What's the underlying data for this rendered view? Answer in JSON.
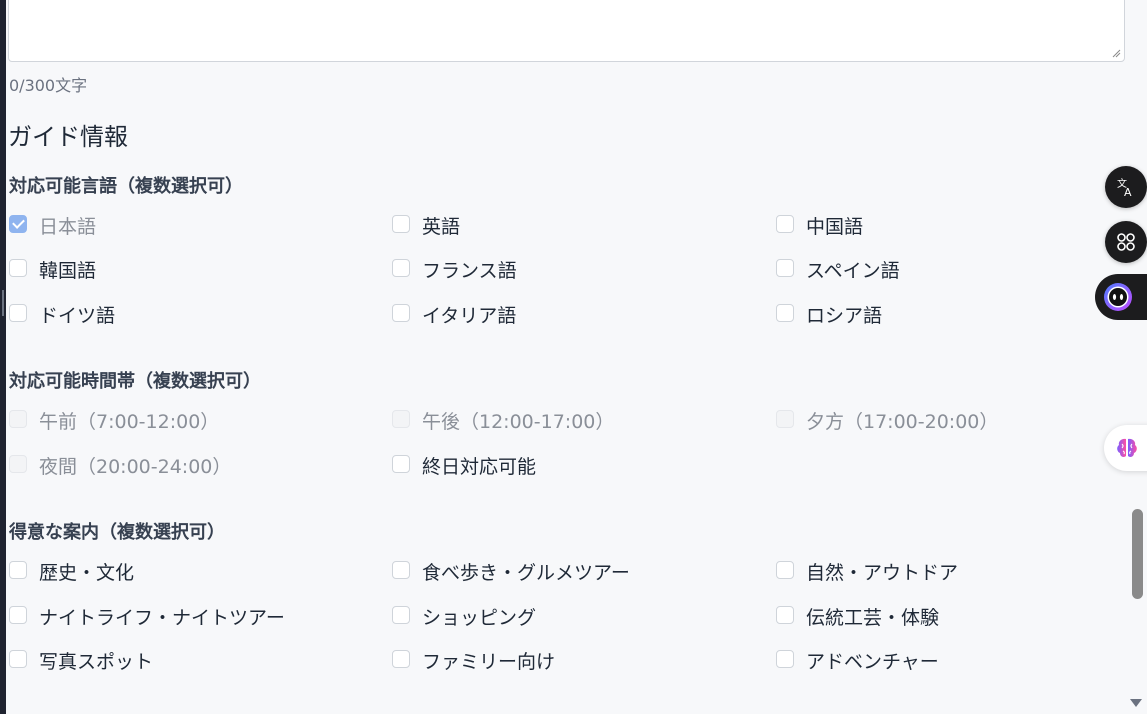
{
  "description_field": {
    "char_count": "0/300文字"
  },
  "guide_section": {
    "title": "ガイド情報",
    "languages": {
      "label": "対応可能言語（複数選択可）",
      "options": [
        {
          "label": "日本語",
          "checked": true,
          "disabled": true
        },
        {
          "label": "英語",
          "checked": false,
          "disabled": false
        },
        {
          "label": "中国語",
          "checked": false,
          "disabled": false
        },
        {
          "label": "韓国語",
          "checked": false,
          "disabled": false
        },
        {
          "label": "フランス語",
          "checked": false,
          "disabled": false
        },
        {
          "label": "スペイン語",
          "checked": false,
          "disabled": false
        },
        {
          "label": "ドイツ語",
          "checked": false,
          "disabled": false
        },
        {
          "label": "イタリア語",
          "checked": false,
          "disabled": false
        },
        {
          "label": "ロシア語",
          "checked": false,
          "disabled": false
        }
      ]
    },
    "time_slots": {
      "label": "対応可能時間帯（複数選択可）",
      "options": [
        {
          "label": "午前（7:00-12:00）",
          "checked": false,
          "disabled": true
        },
        {
          "label": "午後（12:00-17:00）",
          "checked": false,
          "disabled": true
        },
        {
          "label": "夕方（17:00-20:00）",
          "checked": false,
          "disabled": true
        },
        {
          "label": "夜間（20:00-24:00）",
          "checked": false,
          "disabled": true
        },
        {
          "label": "終日対応可能",
          "checked": false,
          "disabled": false
        }
      ]
    },
    "specialties": {
      "label": "得意な案内（複数選択可）",
      "options": [
        {
          "label": "歴史・文化",
          "checked": false,
          "disabled": false
        },
        {
          "label": "食べ歩き・グルメツアー",
          "checked": false,
          "disabled": false
        },
        {
          "label": "自然・アウトドア",
          "checked": false,
          "disabled": false
        },
        {
          "label": "ナイトライフ・ナイトツアー",
          "checked": false,
          "disabled": false
        },
        {
          "label": "ショッピング",
          "checked": false,
          "disabled": false
        },
        {
          "label": "伝統工芸・体験",
          "checked": false,
          "disabled": false
        },
        {
          "label": "写真スポット",
          "checked": false,
          "disabled": false
        },
        {
          "label": "ファミリー向け",
          "checked": false,
          "disabled": false
        },
        {
          "label": "アドベンチャー",
          "checked": false,
          "disabled": false
        }
      ]
    }
  },
  "floating_tools": {
    "translate_icon": "translate-icon",
    "apps_icon": "apps-icon",
    "assistant_icon": "assistant-face-icon",
    "brain_icon": "brain-icon"
  },
  "colors": {
    "checked": "#8fb4ef",
    "background": "#f7f8fa",
    "text": "#1f2937",
    "muted": "#8a8f98"
  }
}
